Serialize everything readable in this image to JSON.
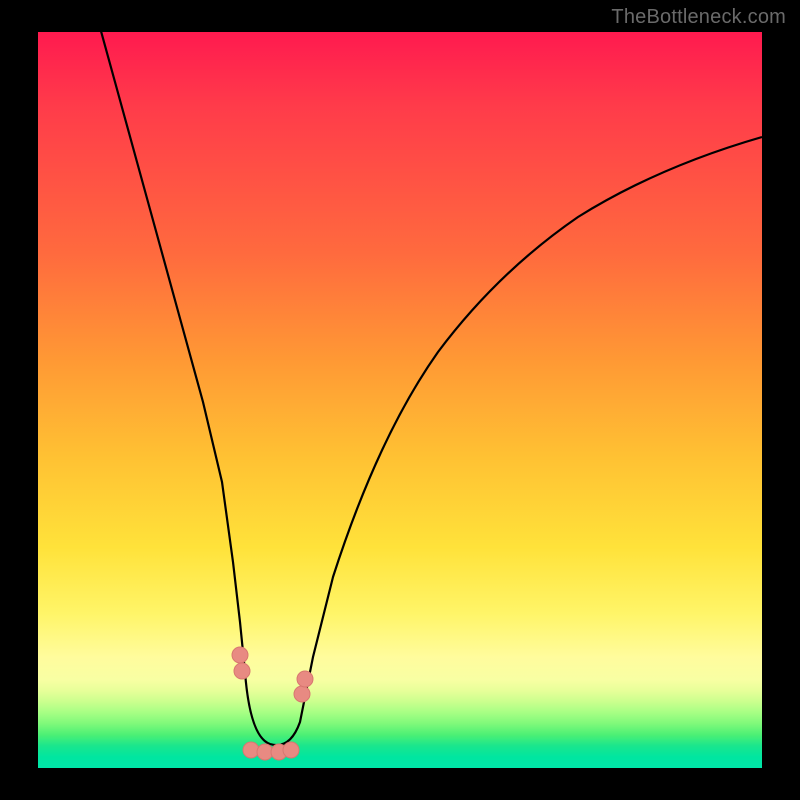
{
  "watermark": "TheBottleneck.com",
  "chart_data": {
    "type": "line",
    "title": "",
    "xlabel": "",
    "ylabel": "",
    "x": [
      0.0,
      0.05,
      0.1,
      0.15,
      0.2,
      0.23,
      0.26,
      0.28,
      0.3,
      0.32,
      0.35,
      0.4,
      0.45,
      0.5,
      0.55,
      0.6,
      0.65,
      0.7,
      0.75,
      0.8,
      0.85,
      0.9,
      0.95,
      1.0
    ],
    "values": [
      1.04,
      0.85,
      0.67,
      0.48,
      0.29,
      0.17,
      0.07,
      0.02,
      0.0,
      0.02,
      0.08,
      0.22,
      0.34,
      0.44,
      0.52,
      0.59,
      0.64,
      0.69,
      0.72,
      0.75,
      0.78,
      0.79,
      0.81,
      0.82
    ],
    "xlim": [
      0,
      1
    ],
    "ylim": [
      0,
      1
    ],
    "annotations": {
      "minimum_region_markers_x": [
        0.24,
        0.25,
        0.27,
        0.28,
        0.3,
        0.31,
        0.33,
        0.34,
        0.35
      ],
      "minimum_region_markers_y": [
        0.13,
        0.1,
        0.015,
        0.015,
        0.015,
        0.015,
        0.015,
        0.1,
        0.12
      ]
    },
    "grid": false,
    "legend": false
  }
}
